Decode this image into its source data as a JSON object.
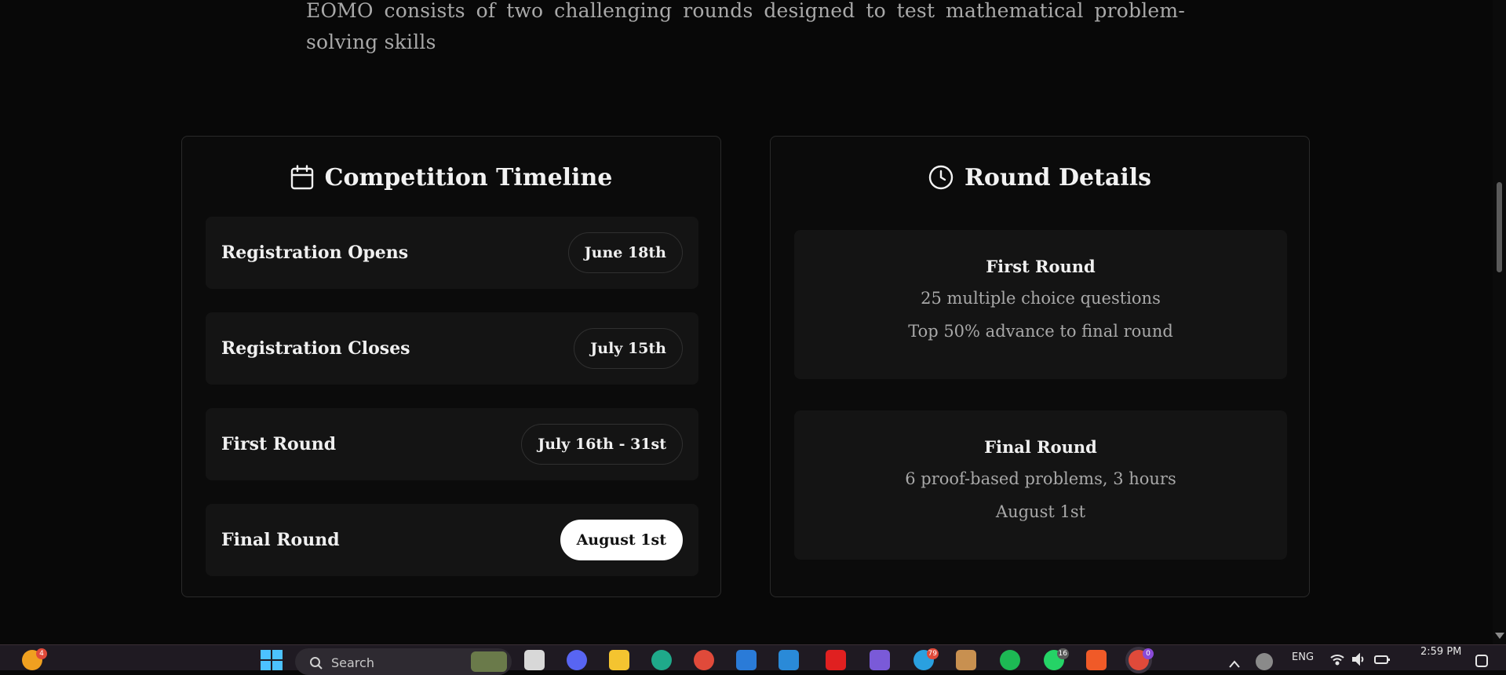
{
  "intro_text": "EOMO consists of two challenging rounds designed to test mathematical problem-solving skills",
  "timeline": {
    "title": "Competition Timeline",
    "icon": "calendar-icon",
    "items": [
      {
        "label": "Registration Opens",
        "date": "June 18th"
      },
      {
        "label": "Registration Closes",
        "date": "July 15th"
      },
      {
        "label": "First Round",
        "date": "July 16th - 31st"
      },
      {
        "label": "Final Round",
        "date": "August 1st"
      }
    ]
  },
  "round_details": {
    "title": "Round Details",
    "icon": "clock-icon",
    "rounds": [
      {
        "name": "First Round",
        "line1": "25 multiple choice questions",
        "line2": "Top 50% advance to final round"
      },
      {
        "name": "Final Round",
        "line1": "6 proof-based problems, 3 hours",
        "line2": "August 1st"
      }
    ]
  },
  "taskbar": {
    "search_placeholder": "Search",
    "language": "ENG",
    "time": "2:59 PM",
    "badges": {
      "widgets": "4",
      "telegram": "79",
      "whatsapp": "16",
      "chrome": "0"
    }
  },
  "colors": {
    "background": "#080808",
    "card": "#0b0b0b",
    "row": "#141414",
    "active_pill": "#ffffff"
  }
}
